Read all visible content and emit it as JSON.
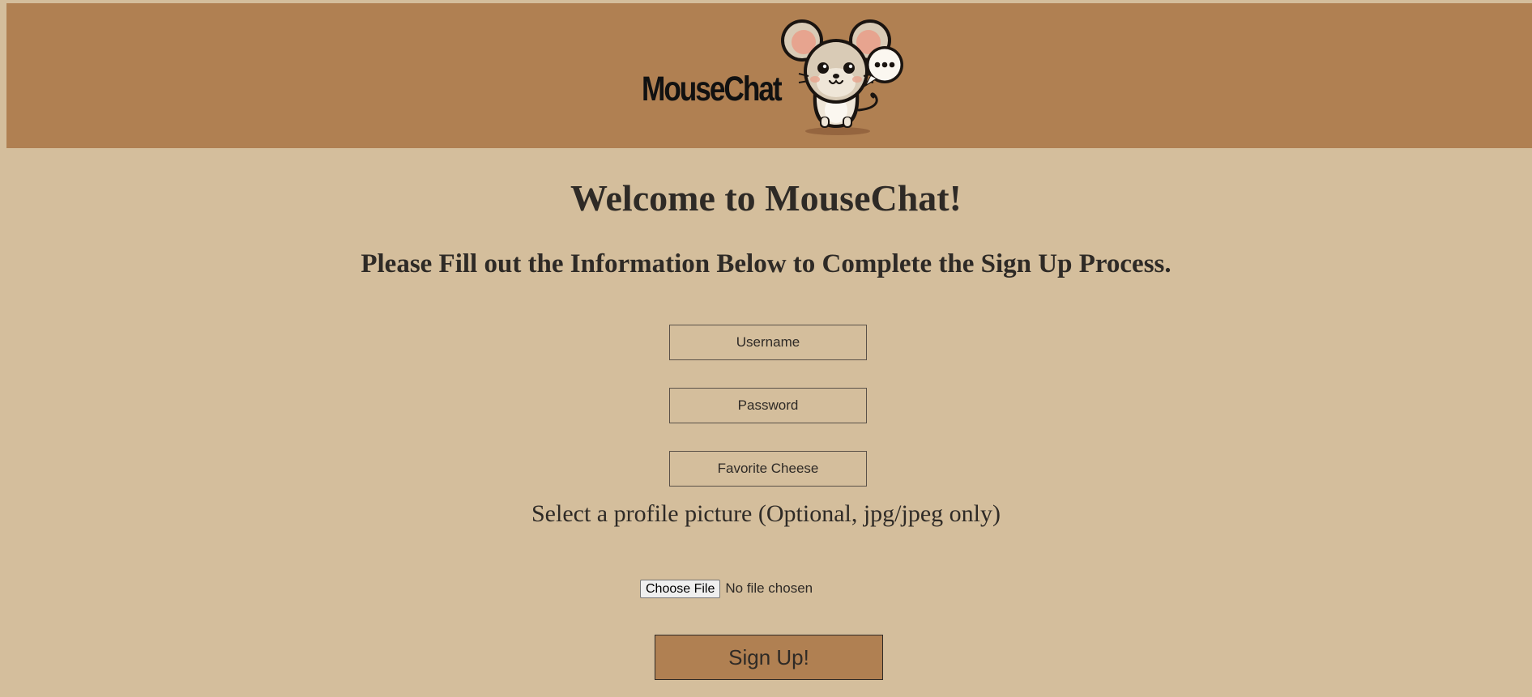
{
  "header": {
    "brand_name": "MouseChat",
    "logo_icon": "mouse-chat-logo-icon"
  },
  "main": {
    "title": "Welcome to MouseChat!",
    "subtitle": "Please Fill out the Information Below to Complete the Sign Up Process."
  },
  "form": {
    "username_placeholder": "Username",
    "username_value": "",
    "password_placeholder": "Password",
    "password_value": "",
    "cheese_placeholder": "Favorite Cheese",
    "cheese_value": "",
    "picture_label": "Select a profile picture (Optional, jpg/jpeg only)",
    "choose_file_label": "Choose File",
    "file_status": "No file chosen",
    "submit_label": "Sign Up!"
  },
  "colors": {
    "page_background": "#d4be9c",
    "header_background": "#b08052",
    "button_background": "#b08052",
    "text": "#2e2a26"
  }
}
